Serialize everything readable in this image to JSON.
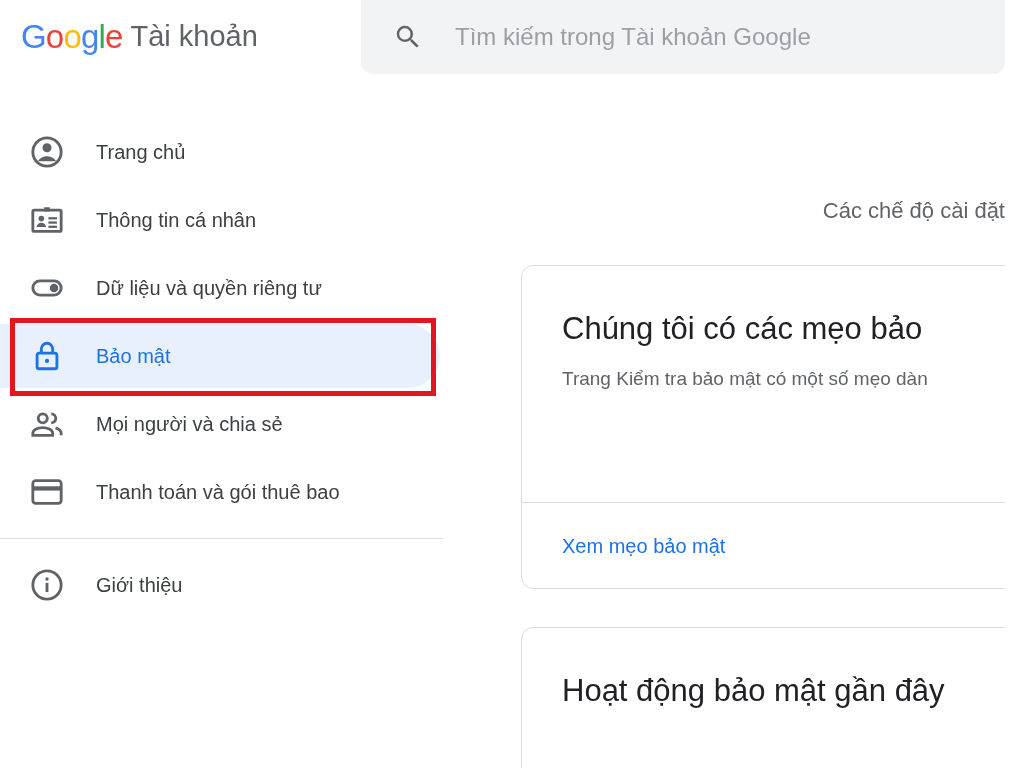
{
  "header": {
    "logo": "Google",
    "product": "Tài khoản",
    "search": {
      "placeholder": "Tìm kiếm trong Tài khoản Google"
    }
  },
  "sidebar": {
    "items": [
      {
        "label": "Trang chủ",
        "kind": "home",
        "selected": false,
        "highlighted": false
      },
      {
        "label": "Thông tin cá nhân",
        "kind": "person",
        "selected": false,
        "highlighted": false
      },
      {
        "label": "Dữ liệu và quyền riêng tư",
        "kind": "toggle",
        "selected": false,
        "highlighted": false
      },
      {
        "label": "Bảo mật",
        "kind": "lock",
        "selected": true,
        "highlighted": true
      },
      {
        "label": "Mọi người và chia sẻ",
        "kind": "people",
        "selected": false,
        "highlighted": false
      },
      {
        "label": "Thanh toán và gói thuê bao",
        "kind": "card",
        "selected": false,
        "highlighted": false
      }
    ],
    "footer_items": [
      {
        "label": "Giới thiệu",
        "kind": "info",
        "selected": false,
        "highlighted": false
      }
    ]
  },
  "main": {
    "intro": "Các chế độ cài đặt",
    "cards": [
      {
        "title": "Chúng tôi có các mẹo bảo",
        "description": "Trang Kiểm tra bảo mật có một số mẹo dàn",
        "link": "Xem mẹo bảo mật"
      },
      {
        "title": "Hoạt động bảo mật gần đây"
      }
    ]
  }
}
